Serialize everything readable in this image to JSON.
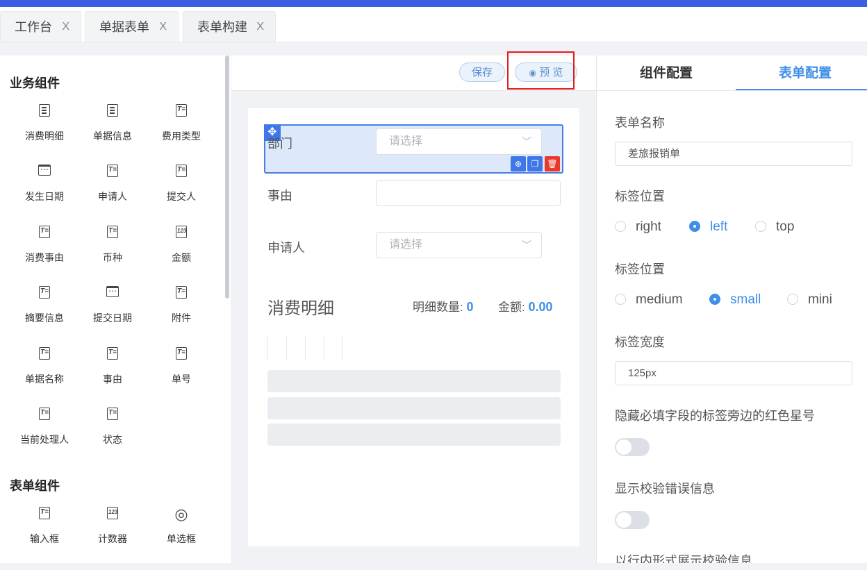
{
  "tabs": [
    {
      "label": "工作台",
      "close": "X"
    },
    {
      "label": "单据表单",
      "close": "X"
    },
    {
      "label": "表单构建",
      "close": "X"
    }
  ],
  "palette": {
    "business_title": "业务组件",
    "business": [
      {
        "label": "消费明细",
        "icon": "document-list-icon"
      },
      {
        "label": "单据信息",
        "icon": "document-list-icon"
      },
      {
        "label": "费用类型",
        "icon": "text-field-icon"
      },
      {
        "label": "发生日期",
        "icon": "calendar-icon"
      },
      {
        "label": "申请人",
        "icon": "text-field-icon"
      },
      {
        "label": "提交人",
        "icon": "text-field-icon"
      },
      {
        "label": "消费事由",
        "icon": "text-field-icon"
      },
      {
        "label": "币种",
        "icon": "text-field-icon"
      },
      {
        "label": "金额",
        "icon": "number-icon"
      },
      {
        "label": "摘要信息",
        "icon": "text-field-icon"
      },
      {
        "label": "提交日期",
        "icon": "calendar-icon"
      },
      {
        "label": "附件",
        "icon": "text-field-icon"
      },
      {
        "label": "单据名称",
        "icon": "text-field-icon"
      },
      {
        "label": "事由",
        "icon": "text-field-icon"
      },
      {
        "label": "单号",
        "icon": "text-field-icon"
      },
      {
        "label": "当前处理人",
        "icon": "text-field-icon"
      },
      {
        "label": "状态",
        "icon": "text-field-icon"
      }
    ],
    "form_title": "表单组件",
    "form": [
      {
        "label": "输入框",
        "icon": "text-field-icon"
      },
      {
        "label": "计数器",
        "icon": "number-icon"
      },
      {
        "label": "单选框",
        "icon": "radio-icon"
      }
    ]
  },
  "toolbar": {
    "save": "保存",
    "preview": "预 览"
  },
  "canvas": {
    "fields": [
      {
        "label": "部门",
        "placeholder": "请选择"
      },
      {
        "label": "事由",
        "placeholder": ""
      },
      {
        "label": "申请人",
        "placeholder": "请选择"
      }
    ],
    "detail": {
      "title": "消费明细",
      "count_label": "明细数量:",
      "count_value": "0",
      "amount_label": "金额:",
      "amount_value": "0.00"
    }
  },
  "config": {
    "tab_component": "组件配置",
    "tab_form": "表单配置",
    "form_name_label": "表单名称",
    "form_name_value": "差旅报销单",
    "label_position_label": "标签位置",
    "label_position_options": [
      "right",
      "left",
      "top"
    ],
    "label_position_selected": "left",
    "size_label": "标签位置",
    "size_options": [
      "medium",
      "small",
      "mini"
    ],
    "size_selected": "small",
    "label_width_label": "标签宽度",
    "label_width_value": "125px",
    "hide_required_label": "隐藏必填字段的标签旁边的红色星号",
    "show_error_label": "显示校验错误信息",
    "inline_error_label": "以行内形式展示校验信息"
  },
  "colors": {
    "accent": "#3f8fe8",
    "brand_bar": "#3c5ee2",
    "highlight": "#e21b1b"
  }
}
